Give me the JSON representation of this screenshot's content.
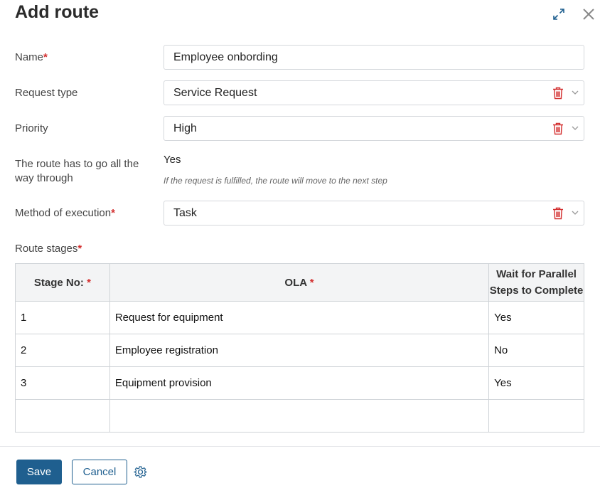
{
  "dialog": {
    "title": "Add route"
  },
  "form": {
    "name": {
      "label": "Name",
      "required_mark": "*",
      "value": "Employee onbording"
    },
    "request_type": {
      "label": "Request type",
      "value": "Service Request"
    },
    "priority": {
      "label": "Priority",
      "value": "High"
    },
    "go_through": {
      "label": "The route has to go all the way through",
      "value": "Yes",
      "hint": "If the request is fulfilled, the route will move to the next step"
    },
    "method": {
      "label": "Method of execution",
      "required_mark": "*",
      "value": "Task"
    },
    "stages_label": "Route stages",
    "stages_required_mark": "*"
  },
  "table": {
    "headers": [
      {
        "text": "Stage No:",
        "required_mark": "*"
      },
      {
        "text": "OLA",
        "required_mark": "*"
      },
      {
        "text": "Wait for Parallel Steps to Complete",
        "required_mark": ""
      }
    ],
    "rows": [
      [
        "1",
        "Request for equipment",
        "Yes"
      ],
      [
        "2",
        "Employee registration",
        "No"
      ],
      [
        "3",
        "Equipment provision",
        "Yes"
      ],
      [
        "",
        "",
        ""
      ]
    ]
  },
  "footer": {
    "save_label": "Save",
    "cancel_label": "Cancel"
  },
  "icons": {
    "expand": "expand-icon",
    "close": "close-icon",
    "trash": "trash-icon",
    "chevron": "chevron-down-icon",
    "gear": "gear-icon"
  },
  "colors": {
    "accent": "#1f5f8f",
    "required": "#d32f2f",
    "trash": "#d32f2f"
  }
}
